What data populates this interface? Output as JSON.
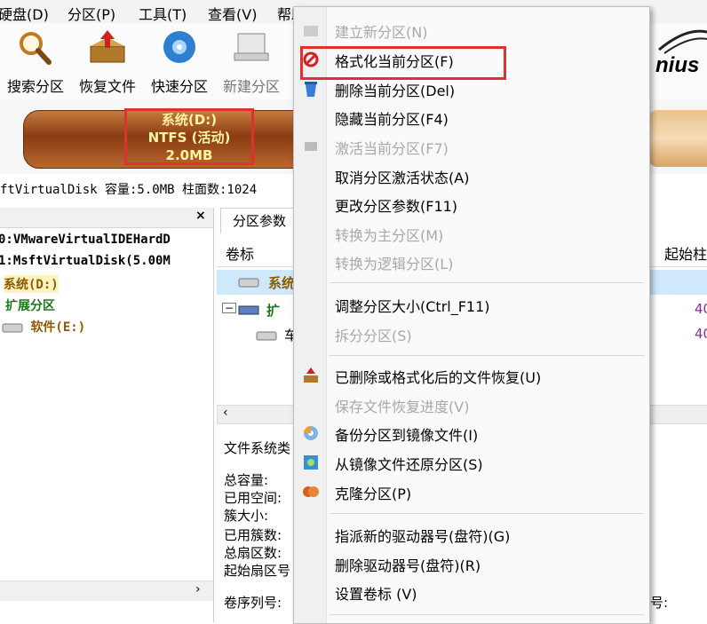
{
  "menubar": {
    "items": [
      "硬盘(D)",
      "分区(P)",
      "工具(T)",
      "查看(V)",
      "帮助(H)"
    ]
  },
  "toolbar": {
    "buttons": [
      {
        "label": "搜索分区",
        "icon": "search-partition-icon"
      },
      {
        "label": "恢复文件",
        "icon": "recover-files-icon"
      },
      {
        "label": "快速分区",
        "icon": "quick-partition-icon"
      },
      {
        "label": "新建分区",
        "icon": "new-partition-icon"
      }
    ],
    "brand_text": "nius"
  },
  "disk_bar": {
    "partition_name": "系统(D:)",
    "partition_fs": "NTFS (活动)",
    "partition_size": "2.0MB"
  },
  "disk_info": "ftVirtualDisk  容量:5.0MB  柱面数:1024",
  "left_tree": {
    "rows": [
      "0:VMwareVirtualIDEHardD",
      "1:MsftVirtualDisk(5.00M",
      "系统(D:)",
      "扩展分区",
      "软件(E:)"
    ],
    "close": "×"
  },
  "right_pane": {
    "tab": "分区参数",
    "header_col1": "卷标",
    "header_col2": "起始柱",
    "rows": [
      {
        "label": "系统",
        "value": ""
      },
      {
        "label": "扩",
        "value": "40"
      },
      {
        "label": "车",
        "value": "40"
      }
    ],
    "fs_label": "文件系统类",
    "info_labels": [
      "总容量:",
      "已用空间:",
      "簇大小:",
      "已用簇数:",
      "总扇区数:",
      "起始扇区号",
      "卷序列号:"
    ],
    "trailing": "号:"
  },
  "context_menu": {
    "items": [
      {
        "label": "建立新分区(N)",
        "disabled": true
      },
      {
        "label": "格式化当前分区(F)",
        "disabled": false
      },
      {
        "label": "删除当前分区(Del)",
        "disabled": false
      },
      {
        "label": "隐藏当前分区(F4)",
        "disabled": false
      },
      {
        "label": "激活当前分区(F7)",
        "disabled": true
      },
      {
        "label": "取消分区激活状态(A)",
        "disabled": false
      },
      {
        "label": "更改分区参数(F11)",
        "disabled": false
      },
      {
        "label": "转换为主分区(M)",
        "disabled": true
      },
      {
        "label": "转换为逻辑分区(L)",
        "disabled": true
      },
      {
        "label": "调整分区大小(Ctrl_F11)",
        "disabled": false
      },
      {
        "label": "拆分分区(S)",
        "disabled": true
      },
      {
        "label": "已删除或格式化后的文件恢复(U)",
        "disabled": false
      },
      {
        "label": "保存文件恢复进度(V)",
        "disabled": true
      },
      {
        "label": "备份分区到镜像文件(I)",
        "disabled": false
      },
      {
        "label": "从镜像文件还原分区(S)",
        "disabled": false
      },
      {
        "label": "克隆分区(P)",
        "disabled": false
      },
      {
        "label": "指派新的驱动器号(盘符)(G)",
        "disabled": false
      },
      {
        "label": "删除驱动器号(盘符)(R)",
        "disabled": false
      },
      {
        "label": "设置卷标 (V)",
        "disabled": false
      }
    ]
  },
  "colors": {
    "highlight_box": "#e03030",
    "selected_row": "#cfe8fb",
    "partition_bar": "#8a3c12",
    "tree_system": "#8a5a00",
    "tree_extended": "#1a7a1a"
  }
}
